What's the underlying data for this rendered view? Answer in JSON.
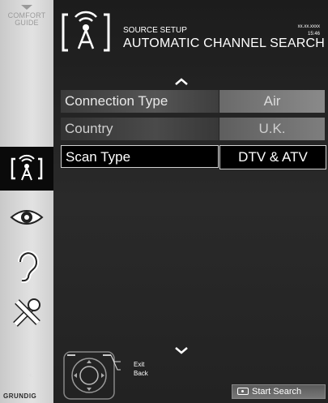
{
  "sidebar": {
    "guide_line1": "COMFORT",
    "guide_line2": "GUIDE",
    "items": [
      {
        "icon": "source-setup-icon",
        "active": true
      },
      {
        "icon": "picture-eye-icon",
        "active": false
      },
      {
        "icon": "sound-ear-icon",
        "active": false
      },
      {
        "icon": "tools-settings-icon",
        "active": false
      }
    ],
    "brand": "GRUNDIG"
  },
  "header": {
    "subtitle": "SOURCE SETUP",
    "title": "AUTOMATIC CHANNEL SEARCH",
    "date": "xx.xx.xxxx",
    "time": "15:46"
  },
  "menu": {
    "rows": [
      {
        "label": "Connection Type",
        "value": "Air",
        "state": "dim"
      },
      {
        "label": "Country",
        "value": "U.K.",
        "state": "dim"
      },
      {
        "label": "Scan Type",
        "value": "DTV & ATV",
        "state": "selected"
      }
    ]
  },
  "footer": {
    "exit_label": "Exit",
    "back_label": "Back",
    "ok_label": "OK",
    "start_search_label": "Start Search"
  },
  "colors": {
    "selected_border": "#d0d0d0",
    "sidebar_bg": "#d8d8d8",
    "background": "#222222"
  }
}
